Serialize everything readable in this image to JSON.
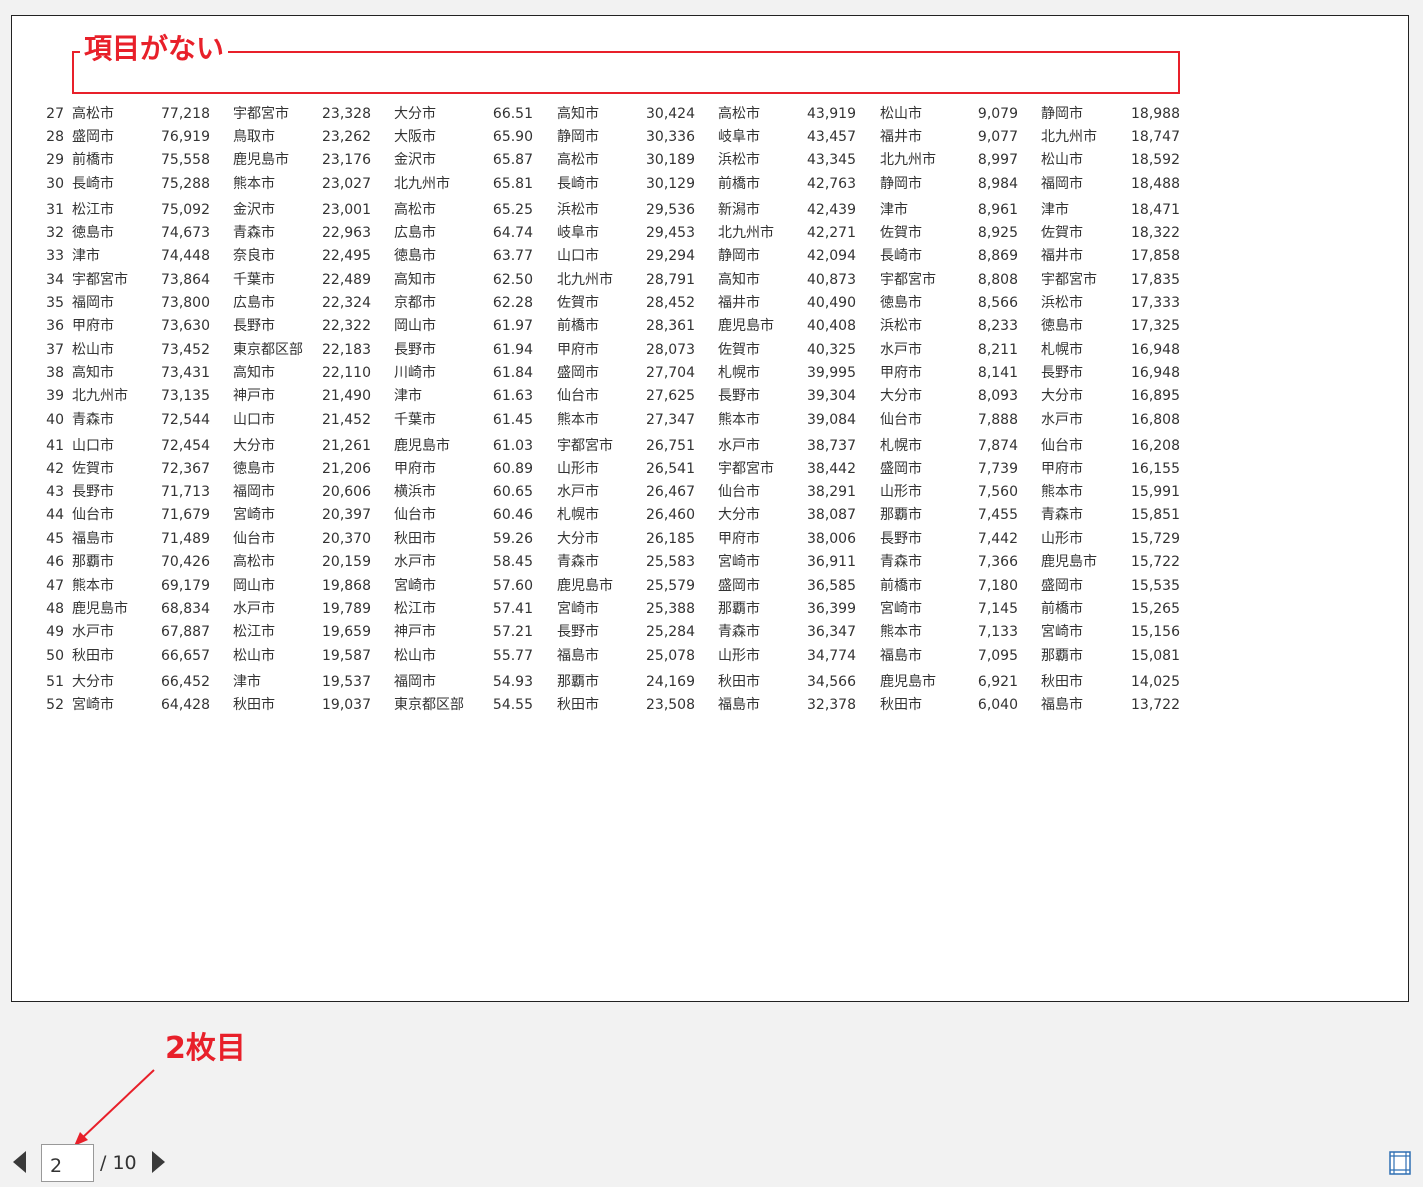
{
  "annotations": {
    "header_missing": "項目がない",
    "second_sheet": "2枚目"
  },
  "colors": {
    "annotation_red": "#e8202a"
  },
  "table": {
    "rows": [
      {
        "rank": "27",
        "c1": "高松市",
        "v1": "77,218",
        "c2": "宇都宮市",
        "v2": "23,328",
        "c3": "大分市",
        "v3": "66.51",
        "c4": "高知市",
        "v4": "30,424",
        "c5": "高松市",
        "v5": "43,919",
        "c6": "松山市",
        "v6": "9,079",
        "c7": "静岡市",
        "v7": "18,988"
      },
      {
        "rank": "28",
        "c1": "盛岡市",
        "v1": "76,919",
        "c2": "鳥取市",
        "v2": "23,262",
        "c3": "大阪市",
        "v3": "65.90",
        "c4": "静岡市",
        "v4": "30,336",
        "c5": "岐阜市",
        "v5": "43,457",
        "c6": "福井市",
        "v6": "9,077",
        "c7": "北九州市",
        "v7": "18,747"
      },
      {
        "rank": "29",
        "c1": "前橋市",
        "v1": "75,558",
        "c2": "鹿児島市",
        "v2": "23,176",
        "c3": "金沢市",
        "v3": "65.87",
        "c4": "高松市",
        "v4": "30,189",
        "c5": "浜松市",
        "v5": "43,345",
        "c6": "北九州市",
        "v6": "8,997",
        "c7": "松山市",
        "v7": "18,592"
      },
      {
        "rank": "30",
        "c1": "長崎市",
        "v1": "75,288",
        "c2": "熊本市",
        "v2": "23,027",
        "c3": "北九州市",
        "v3": "65.81",
        "c4": "長崎市",
        "v4": "30,129",
        "c5": "前橋市",
        "v5": "42,763",
        "c6": "静岡市",
        "v6": "8,984",
        "c7": "福岡市",
        "v7": "18,488"
      },
      {
        "rank": "31",
        "c1": "松江市",
        "v1": "75,092",
        "c2": "金沢市",
        "v2": "23,001",
        "c3": "高松市",
        "v3": "65.25",
        "c4": "浜松市",
        "v4": "29,536",
        "c5": "新潟市",
        "v5": "42,439",
        "c6": "津市",
        "v6": "8,961",
        "c7": "津市",
        "v7": "18,471"
      },
      {
        "rank": "32",
        "c1": "徳島市",
        "v1": "74,673",
        "c2": "青森市",
        "v2": "22,963",
        "c3": "広島市",
        "v3": "64.74",
        "c4": "岐阜市",
        "v4": "29,453",
        "c5": "北九州市",
        "v5": "42,271",
        "c6": "佐賀市",
        "v6": "8,925",
        "c7": "佐賀市",
        "v7": "18,322"
      },
      {
        "rank": "33",
        "c1": "津市",
        "v1": "74,448",
        "c2": "奈良市",
        "v2": "22,495",
        "c3": "徳島市",
        "v3": "63.77",
        "c4": "山口市",
        "v4": "29,294",
        "c5": "静岡市",
        "v5": "42,094",
        "c6": "長崎市",
        "v6": "8,869",
        "c7": "福井市",
        "v7": "17,858"
      },
      {
        "rank": "34",
        "c1": "宇都宮市",
        "v1": "73,864",
        "c2": "千葉市",
        "v2": "22,489",
        "c3": "高知市",
        "v3": "62.50",
        "c4": "北九州市",
        "v4": "28,791",
        "c5": "高知市",
        "v5": "40,873",
        "c6": "宇都宮市",
        "v6": "8,808",
        "c7": "宇都宮市",
        "v7": "17,835"
      },
      {
        "rank": "35",
        "c1": "福岡市",
        "v1": "73,800",
        "c2": "広島市",
        "v2": "22,324",
        "c3": "京都市",
        "v3": "62.28",
        "c4": "佐賀市",
        "v4": "28,452",
        "c5": "福井市",
        "v5": "40,490",
        "c6": "徳島市",
        "v6": "8,566",
        "c7": "浜松市",
        "v7": "17,333"
      },
      {
        "rank": "36",
        "c1": "甲府市",
        "v1": "73,630",
        "c2": "長野市",
        "v2": "22,322",
        "c3": "岡山市",
        "v3": "61.97",
        "c4": "前橋市",
        "v4": "28,361",
        "c5": "鹿児島市",
        "v5": "40,408",
        "c6": "浜松市",
        "v6": "8,233",
        "c7": "徳島市",
        "v7": "17,325"
      },
      {
        "rank": "37",
        "c1": "松山市",
        "v1": "73,452",
        "c2": "東京都区部",
        "v2": "22,183",
        "c3": "長野市",
        "v3": "61.94",
        "c4": "甲府市",
        "v4": "28,073",
        "c5": "佐賀市",
        "v5": "40,325",
        "c6": "水戸市",
        "v6": "8,211",
        "c7": "札幌市",
        "v7": "16,948"
      },
      {
        "rank": "38",
        "c1": "高知市",
        "v1": "73,431",
        "c2": "高知市",
        "v2": "22,110",
        "c3": "川崎市",
        "v3": "61.84",
        "c4": "盛岡市",
        "v4": "27,704",
        "c5": "札幌市",
        "v5": "39,995",
        "c6": "甲府市",
        "v6": "8,141",
        "c7": "長野市",
        "v7": "16,948"
      },
      {
        "rank": "39",
        "c1": "北九州市",
        "v1": "73,135",
        "c2": "神戸市",
        "v2": "21,490",
        "c3": "津市",
        "v3": "61.63",
        "c4": "仙台市",
        "v4": "27,625",
        "c5": "長野市",
        "v5": "39,304",
        "c6": "大分市",
        "v6": "8,093",
        "c7": "大分市",
        "v7": "16,895"
      },
      {
        "rank": "40",
        "c1": "青森市",
        "v1": "72,544",
        "c2": "山口市",
        "v2": "21,452",
        "c3": "千葉市",
        "v3": "61.45",
        "c4": "熊本市",
        "v4": "27,347",
        "c5": "熊本市",
        "v5": "39,084",
        "c6": "仙台市",
        "v6": "7,888",
        "c7": "水戸市",
        "v7": "16,808"
      },
      {
        "rank": "41",
        "c1": "山口市",
        "v1": "72,454",
        "c2": "大分市",
        "v2": "21,261",
        "c3": "鹿児島市",
        "v3": "61.03",
        "c4": "宇都宮市",
        "v4": "26,751",
        "c5": "水戸市",
        "v5": "38,737",
        "c6": "札幌市",
        "v6": "7,874",
        "c7": "仙台市",
        "v7": "16,208"
      },
      {
        "rank": "42",
        "c1": "佐賀市",
        "v1": "72,367",
        "c2": "徳島市",
        "v2": "21,206",
        "c3": "甲府市",
        "v3": "60.89",
        "c4": "山形市",
        "v4": "26,541",
        "c5": "宇都宮市",
        "v5": "38,442",
        "c6": "盛岡市",
        "v6": "7,739",
        "c7": "甲府市",
        "v7": "16,155"
      },
      {
        "rank": "43",
        "c1": "長野市",
        "v1": "71,713",
        "c2": "福岡市",
        "v2": "20,606",
        "c3": "横浜市",
        "v3": "60.65",
        "c4": "水戸市",
        "v4": "26,467",
        "c5": "仙台市",
        "v5": "38,291",
        "c6": "山形市",
        "v6": "7,560",
        "c7": "熊本市",
        "v7": "15,991"
      },
      {
        "rank": "44",
        "c1": "仙台市",
        "v1": "71,679",
        "c2": "宮崎市",
        "v2": "20,397",
        "c3": "仙台市",
        "v3": "60.46",
        "c4": "札幌市",
        "v4": "26,460",
        "c5": "大分市",
        "v5": "38,087",
        "c6": "那覇市",
        "v6": "7,455",
        "c7": "青森市",
        "v7": "15,851"
      },
      {
        "rank": "45",
        "c1": "福島市",
        "v1": "71,489",
        "c2": "仙台市",
        "v2": "20,370",
        "c3": "秋田市",
        "v3": "59.26",
        "c4": "大分市",
        "v4": "26,185",
        "c5": "甲府市",
        "v5": "38,006",
        "c6": "長野市",
        "v6": "7,442",
        "c7": "山形市",
        "v7": "15,729"
      },
      {
        "rank": "46",
        "c1": "那覇市",
        "v1": "70,426",
        "c2": "高松市",
        "v2": "20,159",
        "c3": "水戸市",
        "v3": "58.45",
        "c4": "青森市",
        "v4": "25,583",
        "c5": "宮崎市",
        "v5": "36,911",
        "c6": "青森市",
        "v6": "7,366",
        "c7": "鹿児島市",
        "v7": "15,722"
      },
      {
        "rank": "47",
        "c1": "熊本市",
        "v1": "69,179",
        "c2": "岡山市",
        "v2": "19,868",
        "c3": "宮崎市",
        "v3": "57.60",
        "c4": "鹿児島市",
        "v4": "25,579",
        "c5": "盛岡市",
        "v5": "36,585",
        "c6": "前橋市",
        "v6": "7,180",
        "c7": "盛岡市",
        "v7": "15,535"
      },
      {
        "rank": "48",
        "c1": "鹿児島市",
        "v1": "68,834",
        "c2": "水戸市",
        "v2": "19,789",
        "c3": "松江市",
        "v3": "57.41",
        "c4": "宮崎市",
        "v4": "25,388",
        "c5": "那覇市",
        "v5": "36,399",
        "c6": "宮崎市",
        "v6": "7,145",
        "c7": "前橋市",
        "v7": "15,265"
      },
      {
        "rank": "49",
        "c1": "水戸市",
        "v1": "67,887",
        "c2": "松江市",
        "v2": "19,659",
        "c3": "神戸市",
        "v3": "57.21",
        "c4": "長野市",
        "v4": "25,284",
        "c5": "青森市",
        "v5": "36,347",
        "c6": "熊本市",
        "v6": "7,133",
        "c7": "宮崎市",
        "v7": "15,156"
      },
      {
        "rank": "50",
        "c1": "秋田市",
        "v1": "66,657",
        "c2": "松山市",
        "v2": "19,587",
        "c3": "松山市",
        "v3": "55.77",
        "c4": "福島市",
        "v4": "25,078",
        "c5": "山形市",
        "v5": "34,774",
        "c6": "福島市",
        "v6": "7,095",
        "c7": "那覇市",
        "v7": "15,081"
      },
      {
        "rank": "51",
        "c1": "大分市",
        "v1": "66,452",
        "c2": "津市",
        "v2": "19,537",
        "c3": "福岡市",
        "v3": "54.93",
        "c4": "那覇市",
        "v4": "24,169",
        "c5": "秋田市",
        "v5": "34,566",
        "c6": "鹿児島市",
        "v6": "6,921",
        "c7": "秋田市",
        "v7": "14,025"
      },
      {
        "rank": "52",
        "c1": "宮崎市",
        "v1": "64,428",
        "c2": "秋田市",
        "v2": "19,037",
        "c3": "東京都区部",
        "v3": "54.55",
        "c4": "秋田市",
        "v4": "23,508",
        "c5": "福島市",
        "v5": "32,378",
        "c6": "秋田市",
        "v6": "6,040",
        "c7": "福島市",
        "v7": "13,722"
      }
    ]
  },
  "pagination": {
    "current_page": "2",
    "total_label": "/ 10"
  },
  "icons": {
    "prev": "triangle-left-icon",
    "next": "triangle-right-icon",
    "page_view": "page-layout-icon"
  }
}
